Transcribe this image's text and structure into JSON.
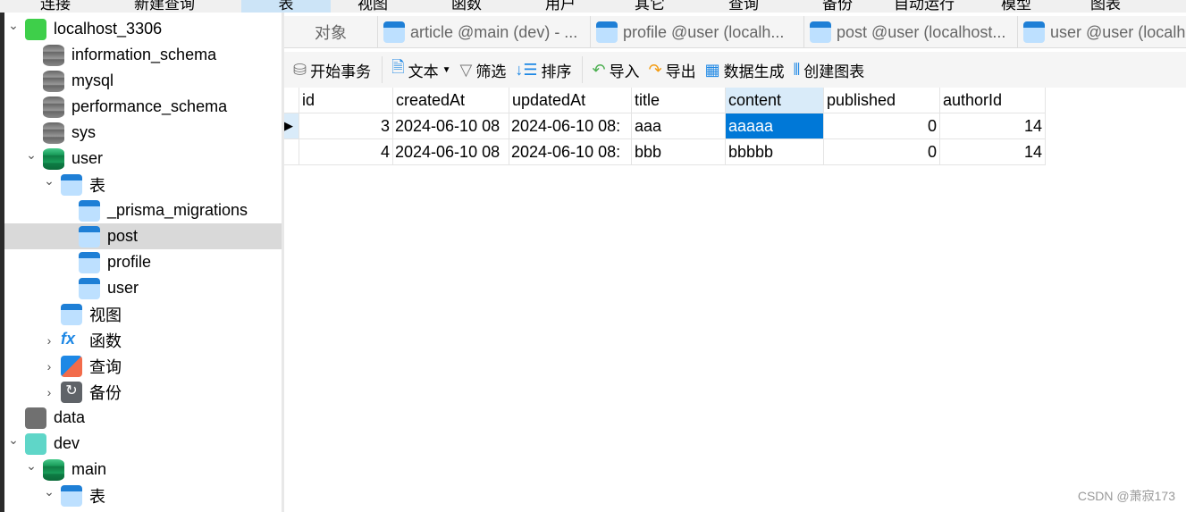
{
  "menubar": [
    "连接",
    "新建查询",
    "表",
    "视图",
    "函数",
    "用户",
    "其它",
    "查询",
    "备份",
    "自动运行",
    "模型",
    "图表"
  ],
  "sidebar": {
    "items": [
      {
        "label": "localhost_3306",
        "icon": "mysql-connection-icon",
        "expanded": true
      },
      {
        "label": "information_schema",
        "icon": "database-icon"
      },
      {
        "label": "mysql",
        "icon": "database-icon"
      },
      {
        "label": "performance_schema",
        "icon": "database-icon"
      },
      {
        "label": "sys",
        "icon": "database-icon"
      },
      {
        "label": "user",
        "icon": "database-open-icon",
        "expanded": true
      },
      {
        "label": "表",
        "icon": "tables-icon",
        "expanded": true
      },
      {
        "label": "_prisma_migrations",
        "icon": "table-icon"
      },
      {
        "label": "post",
        "icon": "table-icon",
        "selected": true
      },
      {
        "label": "profile",
        "icon": "table-icon"
      },
      {
        "label": "user",
        "icon": "table-icon"
      },
      {
        "label": "视图",
        "icon": "view-icon"
      },
      {
        "label": "函数",
        "icon": "function-icon",
        "expanded": false
      },
      {
        "label": "查询",
        "icon": "query-icon",
        "expanded": false
      },
      {
        "label": "备份",
        "icon": "backup-icon",
        "expanded": false
      },
      {
        "label": "data",
        "icon": "sqlite-connection-icon"
      },
      {
        "label": "dev",
        "icon": "sqlite-connection-icon",
        "expanded": true
      },
      {
        "label": "main",
        "icon": "database-open-icon",
        "expanded": true
      },
      {
        "label": "表",
        "icon": "tables-icon",
        "expanded": true
      }
    ]
  },
  "tabs": [
    "对象",
    "article @main (dev) - ...",
    "profile @user (localh...",
    "post @user (localhost...",
    "user @user (localh"
  ],
  "toolbar": {
    "begin_tx": "开始事务",
    "text": "文本",
    "filter": "筛选",
    "sort": "排序",
    "import": "导入",
    "export": "导出",
    "datagen": "数据生成",
    "chart": "创建图表"
  },
  "grid": {
    "columns": [
      "id",
      "createdAt",
      "updatedAt",
      "title",
      "content",
      "published",
      "authorId"
    ],
    "rows": [
      [
        "3",
        "2024-06-10 08",
        "2024-06-10 08:",
        "aaa",
        "aaaaa",
        "0",
        "14"
      ],
      [
        "4",
        "2024-06-10 08",
        "2024-06-10 08:",
        "bbb",
        "bbbbb",
        "0",
        "14"
      ]
    ],
    "selected_cell": {
      "row": 0,
      "column": "content"
    }
  },
  "colors": {
    "selection": "#0078d7",
    "header_selected": "#d9ebf9",
    "accent": "#1e88e5"
  },
  "watermark": "CSDN @萧寂173"
}
